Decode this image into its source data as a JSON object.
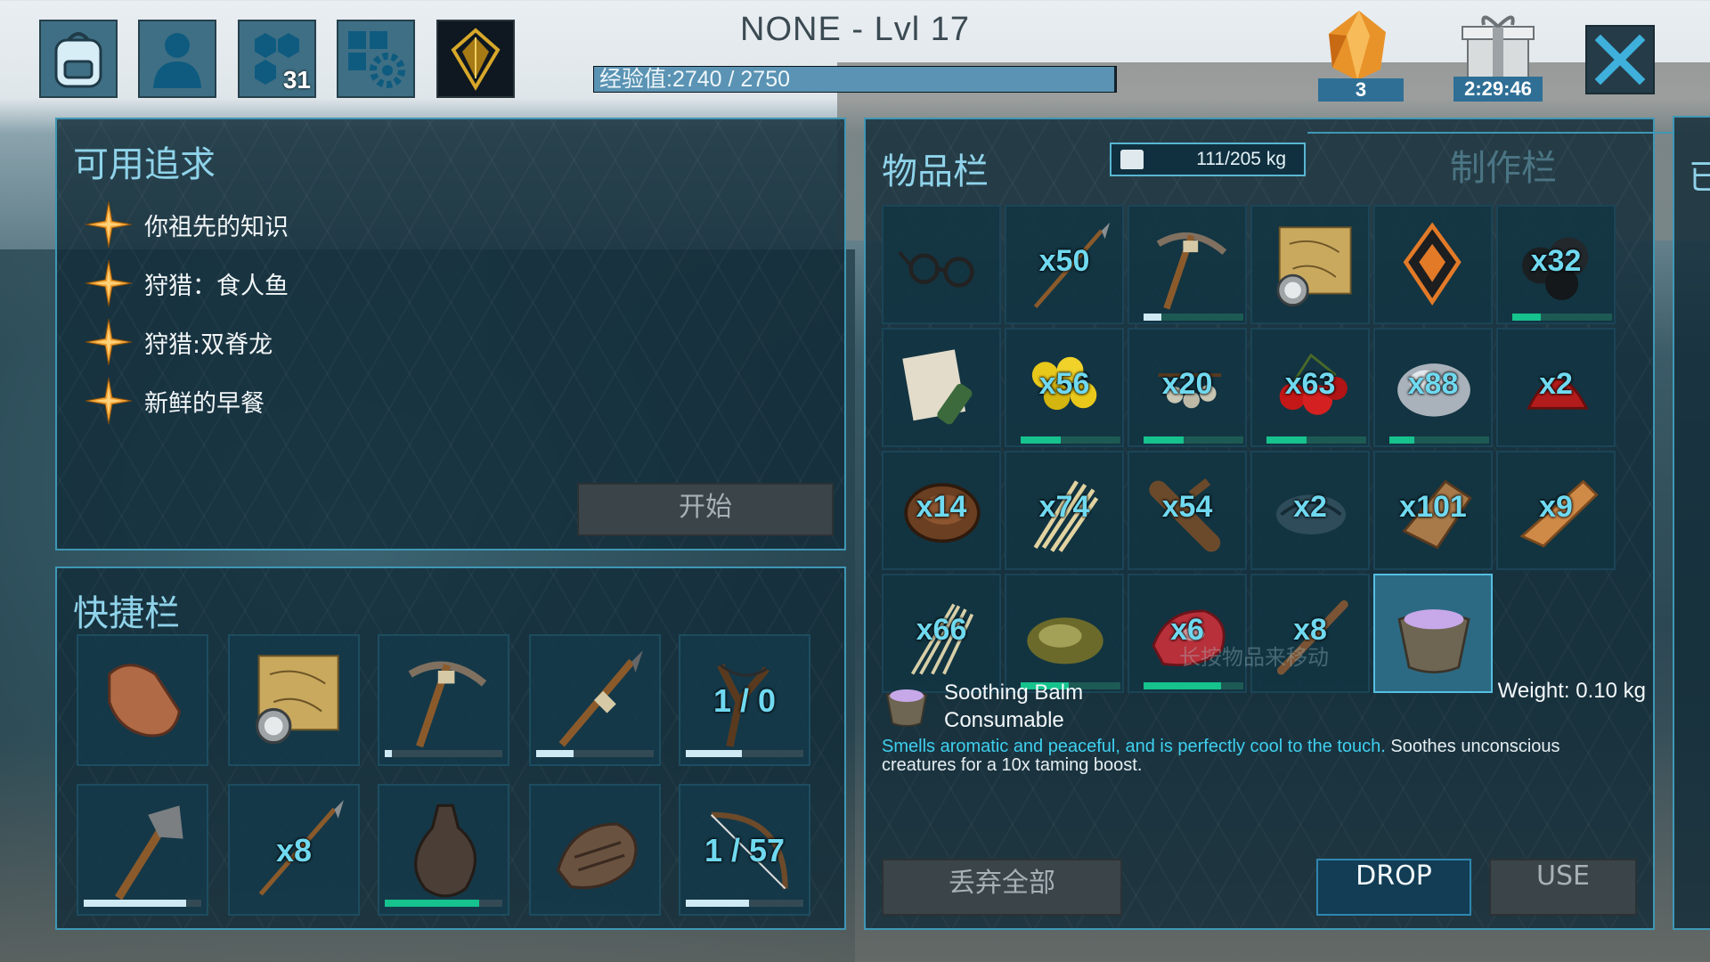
{
  "top": {
    "player_name": "NONE - Lvl 17",
    "xp_text": "经验值:2740 / 2750",
    "xp_fraction": 0.996,
    "engrams_count": "31",
    "element_count": "3",
    "gift_timer": "2:29:46"
  },
  "pursuits": {
    "title": "可用追求",
    "items": [
      {
        "label": "你祖先的知识"
      },
      {
        "label": "狩猎：食人鱼"
      },
      {
        "label": "狩猎:双脊龙"
      },
      {
        "label": "新鲜的早餐"
      }
    ],
    "start_label": "开始"
  },
  "hotbar": {
    "title": "快捷栏",
    "slots": [
      {
        "icon": "hand-icon",
        "qty": "",
        "durability": null
      },
      {
        "icon": "map-compass-icon",
        "qty": "",
        "durability": null
      },
      {
        "icon": "pickaxe-icon",
        "qty": "",
        "durability": 0.06
      },
      {
        "icon": "spear-icon",
        "qty": "",
        "durability": 0.32
      },
      {
        "icon": "slingshot-icon",
        "qty": "1 / 0",
        "durability": 0.48
      },
      {
        "icon": "hatchet-icon",
        "qty": "",
        "durability": 0.87
      },
      {
        "icon": "arrow-icon",
        "qty": "x8",
        "durability": null
      },
      {
        "icon": "waterskin-icon",
        "qty": "",
        "durability": 0.8,
        "green": true
      },
      {
        "icon": "cooked-meat-icon",
        "qty": "",
        "durability": null
      },
      {
        "icon": "bow-icon",
        "qty": "1 / 57",
        "durability": 0.54
      }
    ]
  },
  "inventory": {
    "title": "物品栏",
    "weight": "111/205 kg",
    "crafting_tab": "制作栏",
    "partial_tab": "已",
    "hint": "长按物品来移动",
    "slots": [
      {
        "icon": "glasses-icon",
        "qty": "",
        "durability": null
      },
      {
        "icon": "arrow-icon",
        "qty": "x50",
        "durability": null
      },
      {
        "icon": "pickaxe-icon",
        "qty": "",
        "durability": 0.18,
        "white": true
      },
      {
        "icon": "map-compass-icon",
        "qty": "",
        "durability": null
      },
      {
        "icon": "implant-icon",
        "qty": "",
        "durability": null
      },
      {
        "icon": "coal-icon",
        "qty": "x32",
        "durability": 0.29
      },
      {
        "icon": "note-bottle-icon",
        "qty": "",
        "durability": null
      },
      {
        "icon": "berries-yellow-icon",
        "qty": "x56",
        "durability": 0.4
      },
      {
        "icon": "seeds-icon",
        "qty": "x20",
        "durability": 0.4
      },
      {
        "icon": "berries-red-icon",
        "qty": "x63",
        "durability": 0.4
      },
      {
        "icon": "stone-icon",
        "qty": "x88",
        "durability": 0.25
      },
      {
        "icon": "berries-red-small-icon",
        "qty": "x2",
        "durability": null
      },
      {
        "icon": "hide-icon",
        "qty": "x14",
        "durability": null
      },
      {
        "icon": "thatch-icon",
        "qty": "x74",
        "durability": null
      },
      {
        "icon": "wood-icon",
        "qty": "x54",
        "durability": null
      },
      {
        "icon": "chitin-icon",
        "qty": "x2",
        "durability": null
      },
      {
        "icon": "flint-icon",
        "qty": "x101",
        "durability": null
      },
      {
        "icon": "wood-chunk-icon",
        "qty": "x9",
        "durability": null
      },
      {
        "icon": "fiber-icon",
        "qty": "x66",
        "durability": null
      },
      {
        "icon": "spoiled-meat-icon",
        "qty": "",
        "durability": 0.48
      },
      {
        "icon": "raw-meat-icon",
        "qty": "x6",
        "durability": 0.78
      },
      {
        "icon": "stick-icon",
        "qty": "x8",
        "durability": null
      },
      {
        "icon": "soothing-balm-icon",
        "qty": "",
        "durability": null,
        "selected": true
      }
    ]
  },
  "detail": {
    "name": "Soothing Balm",
    "type": "Consumable",
    "weight": "Weight: 0.10 kg",
    "desc_highlight": "Smells aromatic and peaceful, and is perfectly cool to the touch.",
    "desc_rest": " Soothes unconscious creatures for a 10x taming boost."
  },
  "buttons": {
    "drop_all": "丢弃全部",
    "drop": "DROP",
    "use": "USE"
  },
  "colors": {
    "accent": "#3fd0ef",
    "panel_border": "#3f97b5",
    "title": "#8fd3ea",
    "durability_green": "#16c28d"
  }
}
